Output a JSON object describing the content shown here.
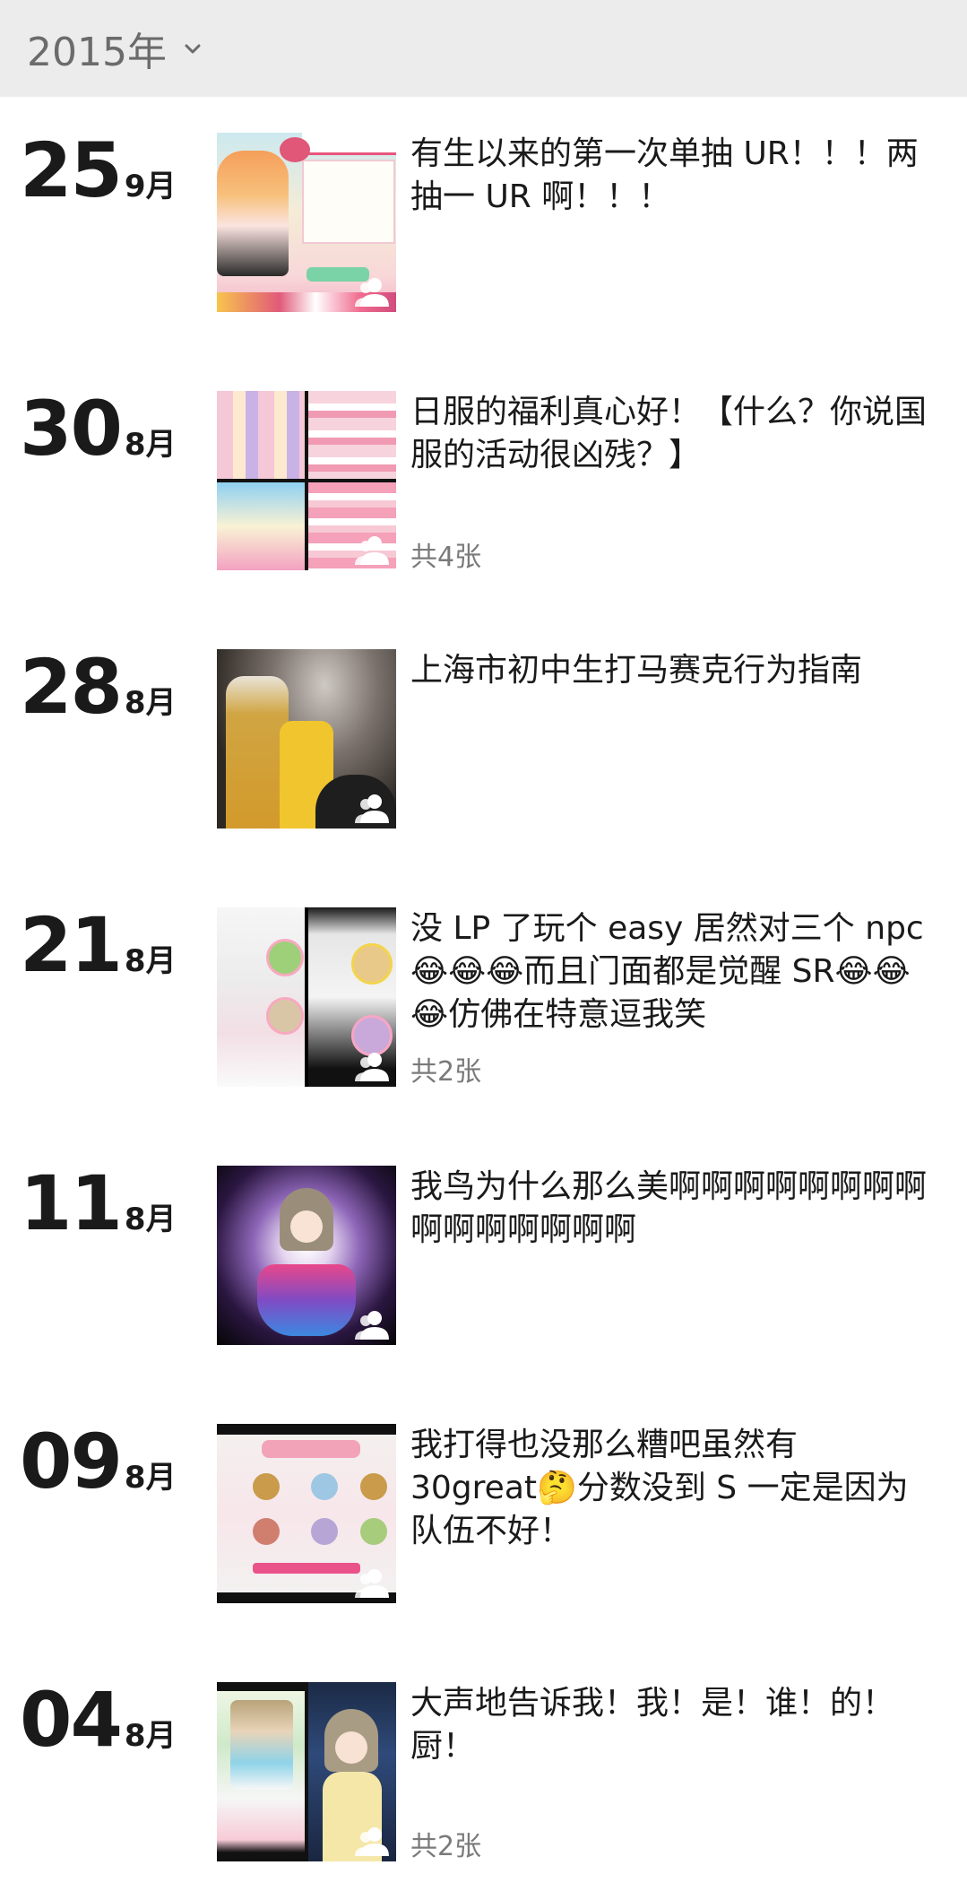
{
  "header": {
    "year": "2015年"
  },
  "posts": [
    {
      "day": "25",
      "month": "9月",
      "text": "有生以来的第一次单抽 UR！！！两抽一 UR 啊！！！",
      "count": ""
    },
    {
      "day": "30",
      "month": "8月",
      "text": "日服的福利真心好！【什么？你说国服的活动很凶残？】",
      "count": "共4张"
    },
    {
      "day": "28",
      "month": "8月",
      "text": "上海市初中生打马赛克行为指南",
      "count": ""
    },
    {
      "day": "21",
      "month": "8月",
      "text_parts": [
        "没 LP 了玩个 easy 居然对三个 npc ",
        "😂😂😂",
        "而且门面都是觉醒 SR",
        "😂😂😂",
        "仿佛在特意逗我笑"
      ],
      "count": "共2张"
    },
    {
      "day": "11",
      "month": "8月",
      "text": "我鸟为什么那么美啊啊啊啊啊啊啊啊啊啊啊啊啊啊啊",
      "count": ""
    },
    {
      "day": "09",
      "month": "8月",
      "text_parts": [
        "我打得也没那么糟吧虽然有 30great",
        "🤔",
        "分数没到 S 一定是因为队伍不好！"
      ],
      "count": ""
    },
    {
      "day": "04",
      "month": "8月",
      "text": "大声地告诉我！我！是！谁！的！厨！",
      "count": "共2张"
    }
  ]
}
